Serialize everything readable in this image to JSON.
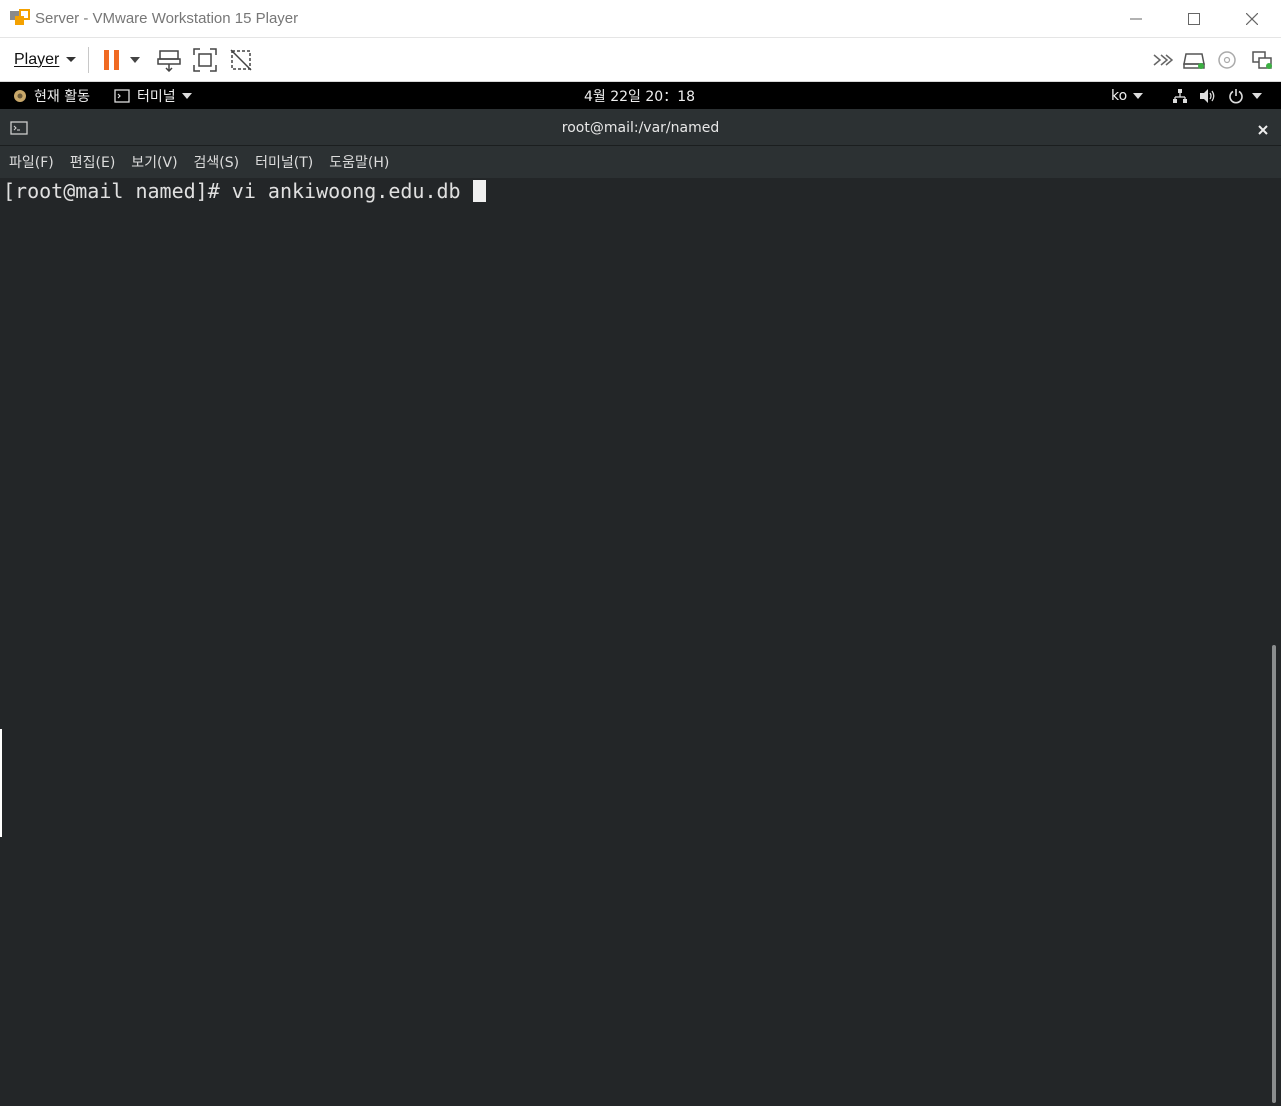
{
  "window": {
    "title": "Server - VMware Workstation 15 Player"
  },
  "toolbar": {
    "player_label": "Player"
  },
  "gnome_bar": {
    "activities": "현재 활동",
    "app_menu": "터미널",
    "clock": "4월 22일  20：18",
    "lang": "ko"
  },
  "terminal": {
    "title": "root@mail:/var/named",
    "menus": [
      "파일(F)",
      "편집(E)",
      "보기(V)",
      "검색(S)",
      "터미널(T)",
      "도움말(H)"
    ],
    "prompt": "[root@mail named]# ",
    "command": "vi ankiwoong.edu.db "
  },
  "colors": {
    "pause_accent": "#f06a22",
    "terminal_bg": "#232628",
    "header_bg": "#2c3133"
  }
}
